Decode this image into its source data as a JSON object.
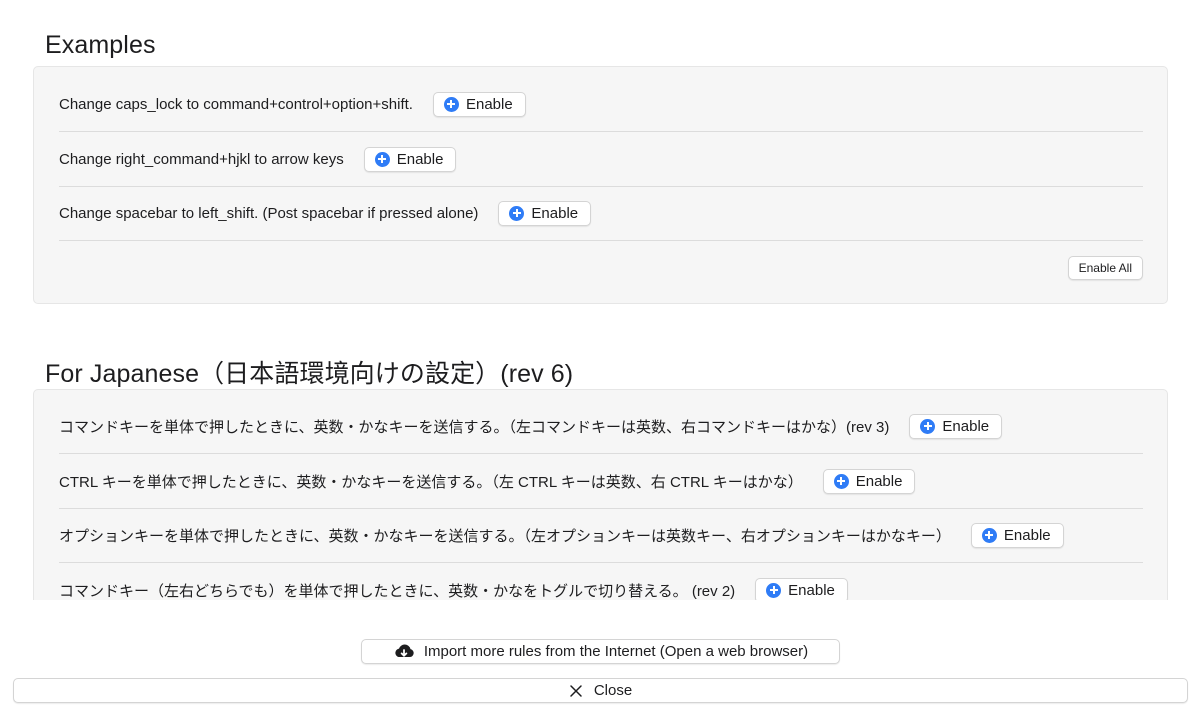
{
  "sections": [
    {
      "title": "Examples",
      "rules": [
        {
          "description": "Change caps_lock to command+control+option+shift.",
          "button": "Enable"
        },
        {
          "description": "Change right_command+hjkl to arrow keys",
          "button": "Enable"
        },
        {
          "description": "Change spacebar to left_shift. (Post spacebar if pressed alone)",
          "button": "Enable"
        }
      ],
      "enable_all_label": "Enable All"
    },
    {
      "title": "For Japanese（日本語環境向けの設定）(rev 6)",
      "rules": [
        {
          "description": "コマンドキーを単体で押したときに、英数・かなキーを送信する。（左コマンドキーは英数、右コマンドキーはかな）(rev 3)",
          "button": "Enable"
        },
        {
          "description": "CTRL キーを単体で押したときに、英数・かなキーを送信する。（左 CTRL キーは英数、右 CTRL キーはかな）",
          "button": "Enable"
        },
        {
          "description": "オプションキーを単体で押したときに、英数・かなキーを送信する。（左オプションキーは英数キー、右オプションキーはかなキー）",
          "button": "Enable"
        },
        {
          "description": "コマンドキー（左右どちらでも）を単体で押したときに、英数・かなをトグルで切り替える。 (rev 2)",
          "button": "Enable"
        }
      ]
    }
  ],
  "footer": {
    "import_label": "Import more rules from the Internet (Open a web browser)",
    "import_icon": "cloud-download-icon",
    "close_label": "Close",
    "close_icon": "close-icon"
  },
  "colors": {
    "accent": "#2f7cf6",
    "group_background": "#f6f6f6"
  }
}
